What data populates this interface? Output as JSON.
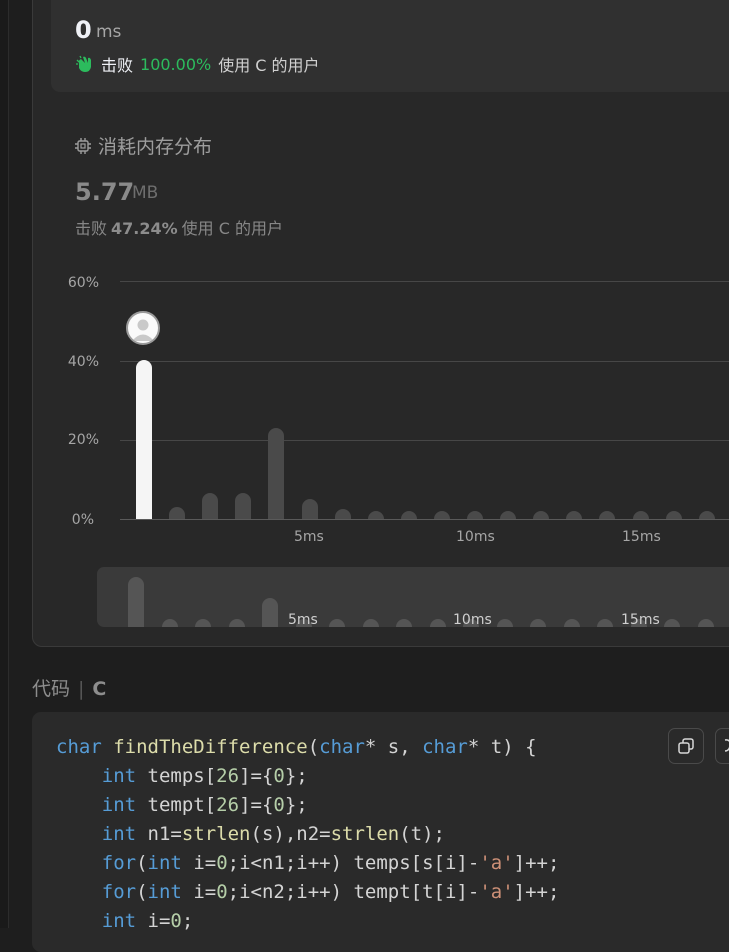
{
  "runtime": {
    "value": "0",
    "unit": "ms",
    "beat_prefix": "击败",
    "beat_pct": "100.00%",
    "beat_suffix": "使用 C 的用户"
  },
  "memory": {
    "title": "消耗内存分布",
    "value": "5.77",
    "unit": "MB",
    "beat_prefix": "击败",
    "beat_pct": "47.24%",
    "beat_suffix": "使用 C 的用户"
  },
  "chart_data": {
    "type": "bar",
    "title": "",
    "ylabel": "",
    "xlabel": "",
    "ylim": [
      0,
      60
    ],
    "y_ticks": [
      "60%",
      "40%",
      "20%",
      "0%"
    ],
    "x_ticks": [
      "5ms",
      "10ms",
      "15ms"
    ],
    "x": [
      0,
      1,
      2,
      3,
      4,
      5,
      6,
      7,
      8,
      9,
      10,
      11,
      12,
      13,
      14,
      15,
      16,
      17
    ],
    "values": [
      40,
      3,
      6.5,
      6.5,
      23,
      5,
      2.5,
      1.5,
      1.5,
      1.5,
      1.5,
      1.5,
      1.5,
      1.5,
      1.5,
      1.5,
      1.5,
      1.5
    ],
    "highlight_index": 0,
    "highlight_color": "#f5f5f5",
    "bar_color": "#4a4a4a",
    "grid": true
  },
  "minimap": {
    "x_ticks": [
      "5ms",
      "10ms",
      "15ms"
    ]
  },
  "code_section": {
    "label": "代码",
    "language": "C"
  },
  "code_lines": [
    [
      {
        "t": "char",
        "c": "kw"
      },
      {
        "t": " "
      },
      {
        "t": "findTheDifference",
        "c": "fn"
      },
      {
        "t": "("
      },
      {
        "t": "char",
        "c": "kw"
      },
      {
        "t": "* s, "
      },
      {
        "t": "char",
        "c": "kw"
      },
      {
        "t": "* t) {"
      }
    ],
    [
      {
        "t": "    "
      },
      {
        "t": "int",
        "c": "kw"
      },
      {
        "t": " temps["
      },
      {
        "t": "26",
        "c": "num"
      },
      {
        "t": "]={"
      },
      {
        "t": "0",
        "c": "num"
      },
      {
        "t": "};"
      }
    ],
    [
      {
        "t": "    "
      },
      {
        "t": "int",
        "c": "kw"
      },
      {
        "t": " tempt["
      },
      {
        "t": "26",
        "c": "num"
      },
      {
        "t": "]={"
      },
      {
        "t": "0",
        "c": "num"
      },
      {
        "t": "};"
      }
    ],
    [
      {
        "t": "    "
      },
      {
        "t": "int",
        "c": "kw"
      },
      {
        "t": " n1="
      },
      {
        "t": "strlen",
        "c": "fn"
      },
      {
        "t": "(s),n2="
      },
      {
        "t": "strlen",
        "c": "fn"
      },
      {
        "t": "(t);"
      }
    ],
    [
      {
        "t": "    "
      },
      {
        "t": "for",
        "c": "kw"
      },
      {
        "t": "("
      },
      {
        "t": "int",
        "c": "kw"
      },
      {
        "t": " i="
      },
      {
        "t": "0",
        "c": "num"
      },
      {
        "t": ";i<n1;i++) temps[s[i]-"
      },
      {
        "t": "'a'",
        "c": "str"
      },
      {
        "t": "]++;"
      }
    ],
    [
      {
        "t": "    "
      },
      {
        "t": "for",
        "c": "kw"
      },
      {
        "t": "("
      },
      {
        "t": "int",
        "c": "kw"
      },
      {
        "t": " i="
      },
      {
        "t": "0",
        "c": "num"
      },
      {
        "t": ";i<n2;i++) tempt[t[i]-"
      },
      {
        "t": "'a'",
        "c": "str"
      },
      {
        "t": "]++;"
      }
    ],
    [
      {
        "t": "    "
      },
      {
        "t": "int",
        "c": "kw"
      },
      {
        "t": " i="
      },
      {
        "t": "0",
        "c": "num"
      },
      {
        "t": ";"
      }
    ]
  ]
}
